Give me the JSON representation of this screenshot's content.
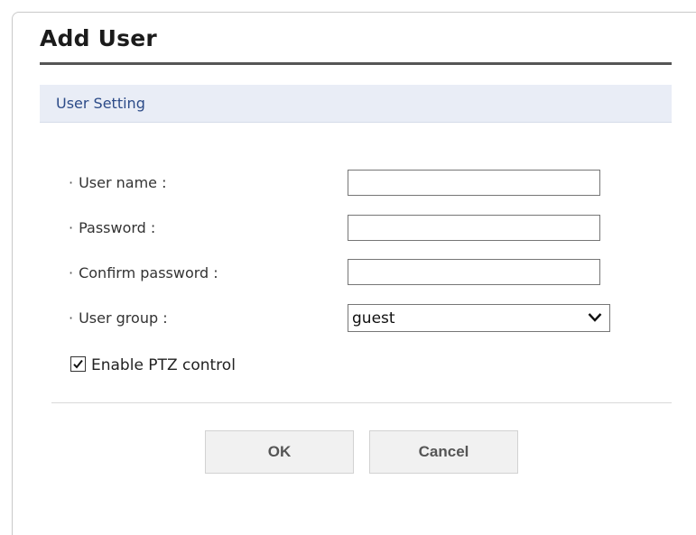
{
  "dialog": {
    "title": "Add User"
  },
  "section": {
    "title": "User Setting"
  },
  "fields": {
    "bullet": "·",
    "username": {
      "label": "User name :",
      "value": ""
    },
    "password": {
      "label": "Password :",
      "value": ""
    },
    "confirm_password": {
      "label": "Confirm password :",
      "value": ""
    },
    "user_group": {
      "label": "User group :",
      "selected": "guest"
    }
  },
  "ptz": {
    "label": "Enable PTZ control",
    "checked": true
  },
  "buttons": {
    "ok": "OK",
    "cancel": "Cancel"
  },
  "colors": {
    "section_bg": "#e9edf6",
    "section_text": "#2c4b88",
    "button_bg": "#f1f1f1",
    "rule": "#555555"
  }
}
